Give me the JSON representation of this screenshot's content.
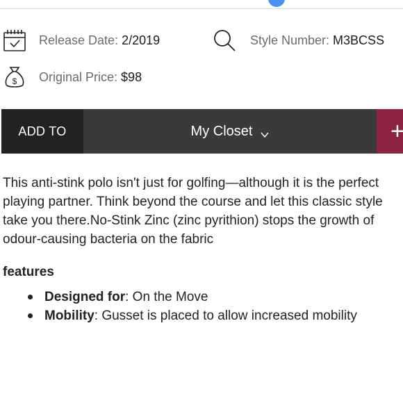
{
  "meta": {
    "release": {
      "label": "Release Date:",
      "value": "2/2019",
      "icon": "calendar-icon"
    },
    "style": {
      "label": "Style Number:",
      "value": "M3BCSS",
      "icon": "search-icon"
    },
    "price": {
      "label": "Original Price:",
      "value": "$98",
      "icon": "money-bag-icon"
    }
  },
  "action_bar": {
    "add_to_label": "ADD TO",
    "closet_label": "My Closet",
    "plus_label": "+",
    "colors": {
      "bar": "#3a3a3a",
      "add_to": "#222222",
      "plus": "#8a2440"
    }
  },
  "description_lines": [
    "This anti-stink polo isn't just for golfing—although it is the perfect",
    "playing partner. Think beyond the course and let this classic style",
    "take you there.No-Stink Zinc (zinc pyrithion) stops the growth of",
    "odour-causing bacteria on the fabric"
  ],
  "features": {
    "heading": "features",
    "items": [
      {
        "name": "Designed for",
        "sep": ":",
        "value": " On the Move"
      },
      {
        "name": "Mobility",
        "sep": ":",
        "value": " Gusset is placed to allow increased mobility"
      }
    ]
  }
}
